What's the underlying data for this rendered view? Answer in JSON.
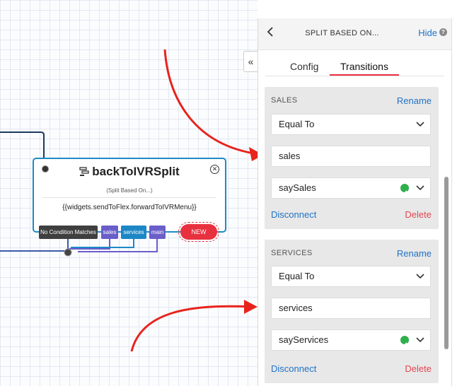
{
  "canvas": {
    "widget": {
      "name": "backToIVRSplit",
      "type_label": "(Split Based On...)",
      "expression": "{{widgets.sendToFlex.forwardToIVRMenu}}",
      "close_icon": "close-circle-icon",
      "widget_icon": "split-icon"
    },
    "transitions": [
      "No Condition Matches",
      "sales",
      "services",
      "main"
    ],
    "new_label": "NEW",
    "collapse_label": "«"
  },
  "panel": {
    "back_icon": "chevron-left-icon",
    "title": "SPLIT BASED ON...",
    "hide_label": "Hide",
    "help_label": "?",
    "tabs": [
      {
        "label": "Config",
        "active": false
      },
      {
        "label": "Transitions",
        "active": true
      }
    ],
    "cards": [
      {
        "label": "SALES",
        "rename": "Rename",
        "operator": "Equal To",
        "value": "sales",
        "target": "saySales",
        "disconnect": "Disconnect",
        "delete": "Delete"
      },
      {
        "label": "SERVICES",
        "rename": "Rename",
        "operator": "Equal To",
        "value": "services",
        "target": "sayServices",
        "disconnect": "Disconnect",
        "delete": "Delete"
      }
    ]
  },
  "colors": {
    "accent_blue": "#1f72c6",
    "widget_border": "#1f8ac6",
    "new_red": "#e8313f",
    "delete_red": "#e34552",
    "annotation_red": "#e8231c",
    "ok_green": "#2fb04c"
  }
}
